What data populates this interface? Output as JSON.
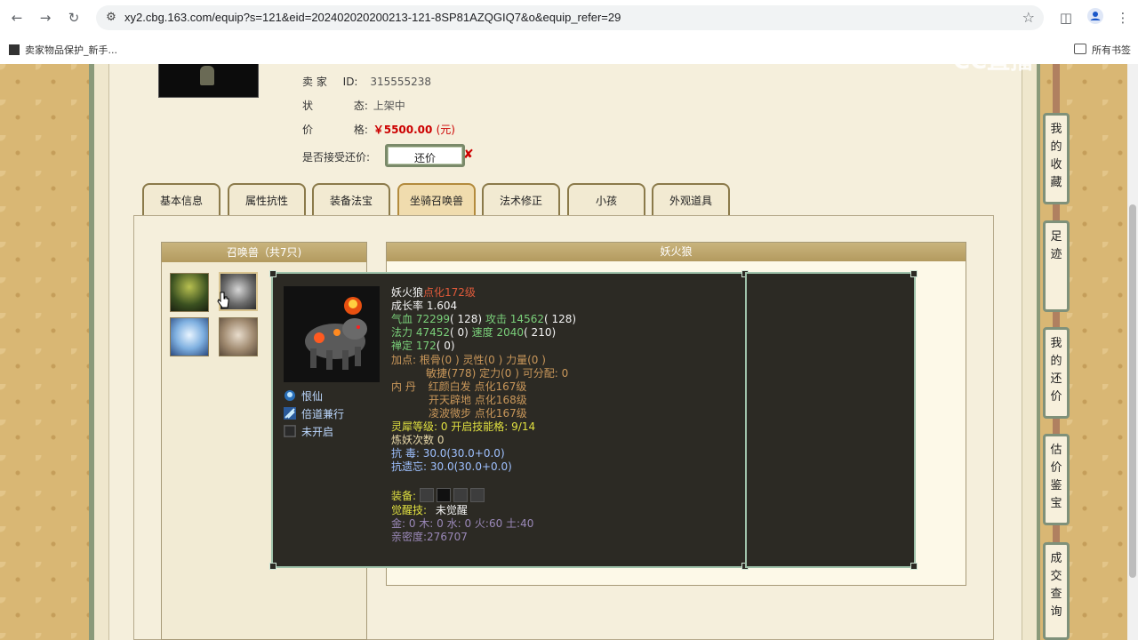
{
  "browser": {
    "url": "xy2.cbg.163.com/equip?s=121&eid=202402020200213-121-8SP81AZQGIQ7&o&equip_refer=29",
    "bookmark_item": "卖家物品保护_新手...",
    "bookmarks_all": "所有书签"
  },
  "watermark": "CC直播",
  "seller": {
    "seller_label": "卖 家",
    "id_label": "ID:",
    "id_value": "315555238",
    "status_label": "状",
    "status_label2": "态:",
    "status_value": "上架中",
    "price_label": "价",
    "price_label2": "格:",
    "price_value": "￥5500.00",
    "price_unit": "(元)",
    "counter_label": "是否接受还价:",
    "counter_button": "还价"
  },
  "tabs": [
    "基本信息",
    "属性抗性",
    "装备法宝",
    "坐骑召唤兽",
    "法术修正",
    "小孩",
    "外观道具"
  ],
  "active_tab": "坐骑召唤兽",
  "pet_list_header": "召唤兽（共7只)",
  "detail_header": "妖火狼",
  "pet": {
    "name": "妖火狼",
    "level": "点化172级",
    "growth": "成长率 1.604",
    "hp_label": "气血",
    "hp": "72299",
    "hp_extra": "( 128)",
    "atk_label": "攻击",
    "atk": "14562",
    "atk_extra": "( 128)",
    "mp_label": "法力",
    "mp": "47452",
    "mp_extra": "( 0)",
    "spd_label": "速度",
    "spd": "2040",
    "spd_extra": "( 210)",
    "zen_label": "禅定",
    "zen": "172",
    "zen_extra": "( 0)",
    "points_line1": "加点:  根骨(0 ) 灵性(0 ) 力量(0 )",
    "points_line2": "敏捷(778) 定力(0 ) 可分配:  0",
    "neidan_label": "内  丹",
    "neidan1": "红颜白发 点化167级",
    "neidan2": "开天辟地 点化168级",
    "neidan3": "凌波微步 点化167级",
    "lingxi": "灵犀等级:  0 开启技能格:  9/14",
    "lianyao": "炼妖次数 0",
    "resist1_label": "抗    毒:",
    "resist1": "30.0(30.0+0.0)",
    "resist2_label": "抗遗忘:",
    "resist2": "30.0(30.0+0.0)",
    "equip_label": "装备:",
    "awaken_label": "觉醒技:",
    "awaken_value": "未觉醒",
    "elements": "金: 0 木: 0 水: 0 火:60 土:40",
    "intimacy": "亲密度:276707"
  },
  "skills": [
    {
      "icon": "ghost-skill-icon",
      "label": "恨仙"
    },
    {
      "icon": "dash-skill-icon",
      "label": "倍道兼行"
    },
    {
      "icon": "locked-skill-icon",
      "label": "未开启"
    }
  ],
  "sidebar": [
    "我的收藏",
    "足迹",
    "我的还价",
    "估价鉴宝",
    "成交查询"
  ],
  "colors": {
    "accent": "#9fc2aa",
    "price": "#cc0000",
    "tooltip_bg": "#2c2a24"
  }
}
